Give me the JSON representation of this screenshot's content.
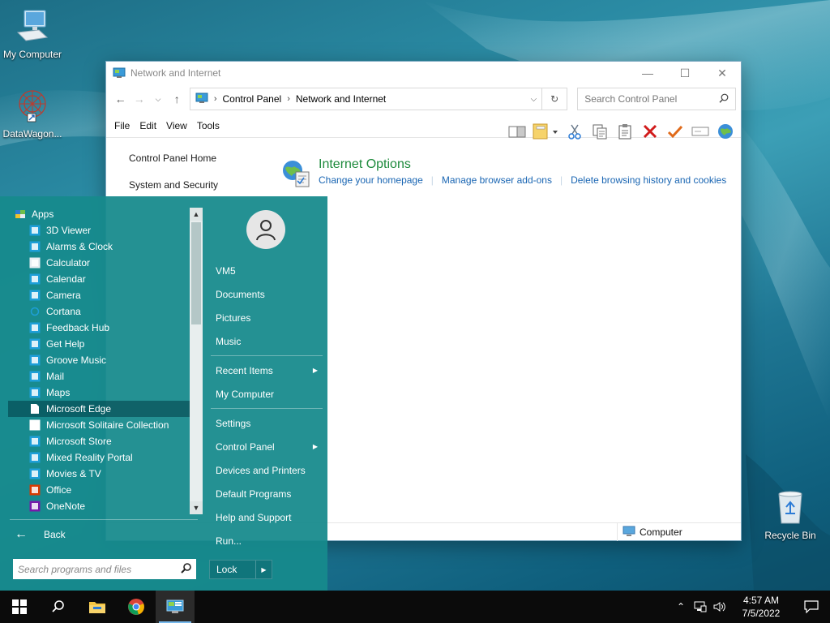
{
  "desktop": {
    "icons": [
      {
        "label": "My Computer",
        "icon": "computer-icon"
      },
      {
        "label": "DataWagon...",
        "icon": "datawagon-icon"
      },
      {
        "label": "Recycle Bin",
        "icon": "recycle-bin-icon"
      }
    ]
  },
  "window": {
    "title": "Network and Internet",
    "address": {
      "crumbs": [
        "Control Panel",
        "Network and Internet"
      ]
    },
    "search_placeholder": "Search Control Panel",
    "menu": [
      "File",
      "Edit",
      "View",
      "Tools"
    ],
    "toolbar_icons": [
      "preview-pane-icon",
      "views-icon",
      "cut-icon",
      "copy-icon",
      "paste-icon",
      "delete-icon",
      "properties-check-icon",
      "rename-icon",
      "internet-globe-icon"
    ],
    "left_pane": [
      "Control Panel Home",
      "System and Security"
    ],
    "category": {
      "title": "Internet Options",
      "links": [
        "Change your homepage",
        "Manage browser add-ons",
        "Delete browsing history and cookies"
      ]
    },
    "status": {
      "location": "Computer"
    }
  },
  "start_menu": {
    "apps_header": "Apps",
    "apps": [
      {
        "label": "3D Viewer",
        "icon": "cube-icon"
      },
      {
        "label": "Alarms & Clock",
        "icon": "alarm-icon"
      },
      {
        "label": "Calculator",
        "icon": "calculator-icon"
      },
      {
        "label": "Calendar",
        "icon": "calendar-icon"
      },
      {
        "label": "Camera",
        "icon": "camera-icon"
      },
      {
        "label": "Cortana",
        "icon": "cortana-icon"
      },
      {
        "label": "Feedback Hub",
        "icon": "feedback-icon"
      },
      {
        "label": "Get Help",
        "icon": "help-icon"
      },
      {
        "label": "Groove Music",
        "icon": "music-icon"
      },
      {
        "label": "Mail",
        "icon": "mail-icon"
      },
      {
        "label": "Maps",
        "icon": "maps-icon"
      },
      {
        "label": "Microsoft Edge",
        "icon": "document-icon"
      },
      {
        "label": "Microsoft Solitaire Collection",
        "icon": "cards-icon"
      },
      {
        "label": "Microsoft Store",
        "icon": "store-icon"
      },
      {
        "label": "Mixed Reality Portal",
        "icon": "mixed-reality-icon"
      },
      {
        "label": "Movies & TV",
        "icon": "movies-icon"
      },
      {
        "label": "Office",
        "icon": "office-icon"
      },
      {
        "label": "OneNote",
        "icon": "onenote-icon"
      }
    ],
    "highlighted_app": "Microsoft Edge",
    "back_label": "Back",
    "search_placeholder": "Search programs and files",
    "user_links": [
      {
        "label": "VM5"
      },
      {
        "label": "Documents"
      },
      {
        "label": "Pictures"
      },
      {
        "label": "Music"
      }
    ],
    "recent_links": [
      {
        "label": "Recent Items",
        "submenu": true
      },
      {
        "label": "My Computer",
        "submenu": false
      }
    ],
    "system_links": [
      {
        "label": "Settings",
        "submenu": false
      },
      {
        "label": "Control Panel",
        "submenu": true
      },
      {
        "label": "Devices and Printers",
        "submenu": false
      },
      {
        "label": "Default Programs",
        "submenu": false
      },
      {
        "label": "Help and Support",
        "submenu": false
      },
      {
        "label": "Run...",
        "submenu": false
      }
    ],
    "lock_label": "Lock"
  },
  "taskbar": {
    "items": [
      "start-icon",
      "search-icon",
      "file-explorer-icon",
      "chrome-icon",
      "control-panel-icon"
    ],
    "time": "4:57 AM",
    "date": "7/5/2022"
  },
  "colors": {
    "start_bg": "#168a8c",
    "link": "#1a66b3",
    "category_title": "#1e8a3c",
    "taskbar": "#0b0b0b"
  }
}
